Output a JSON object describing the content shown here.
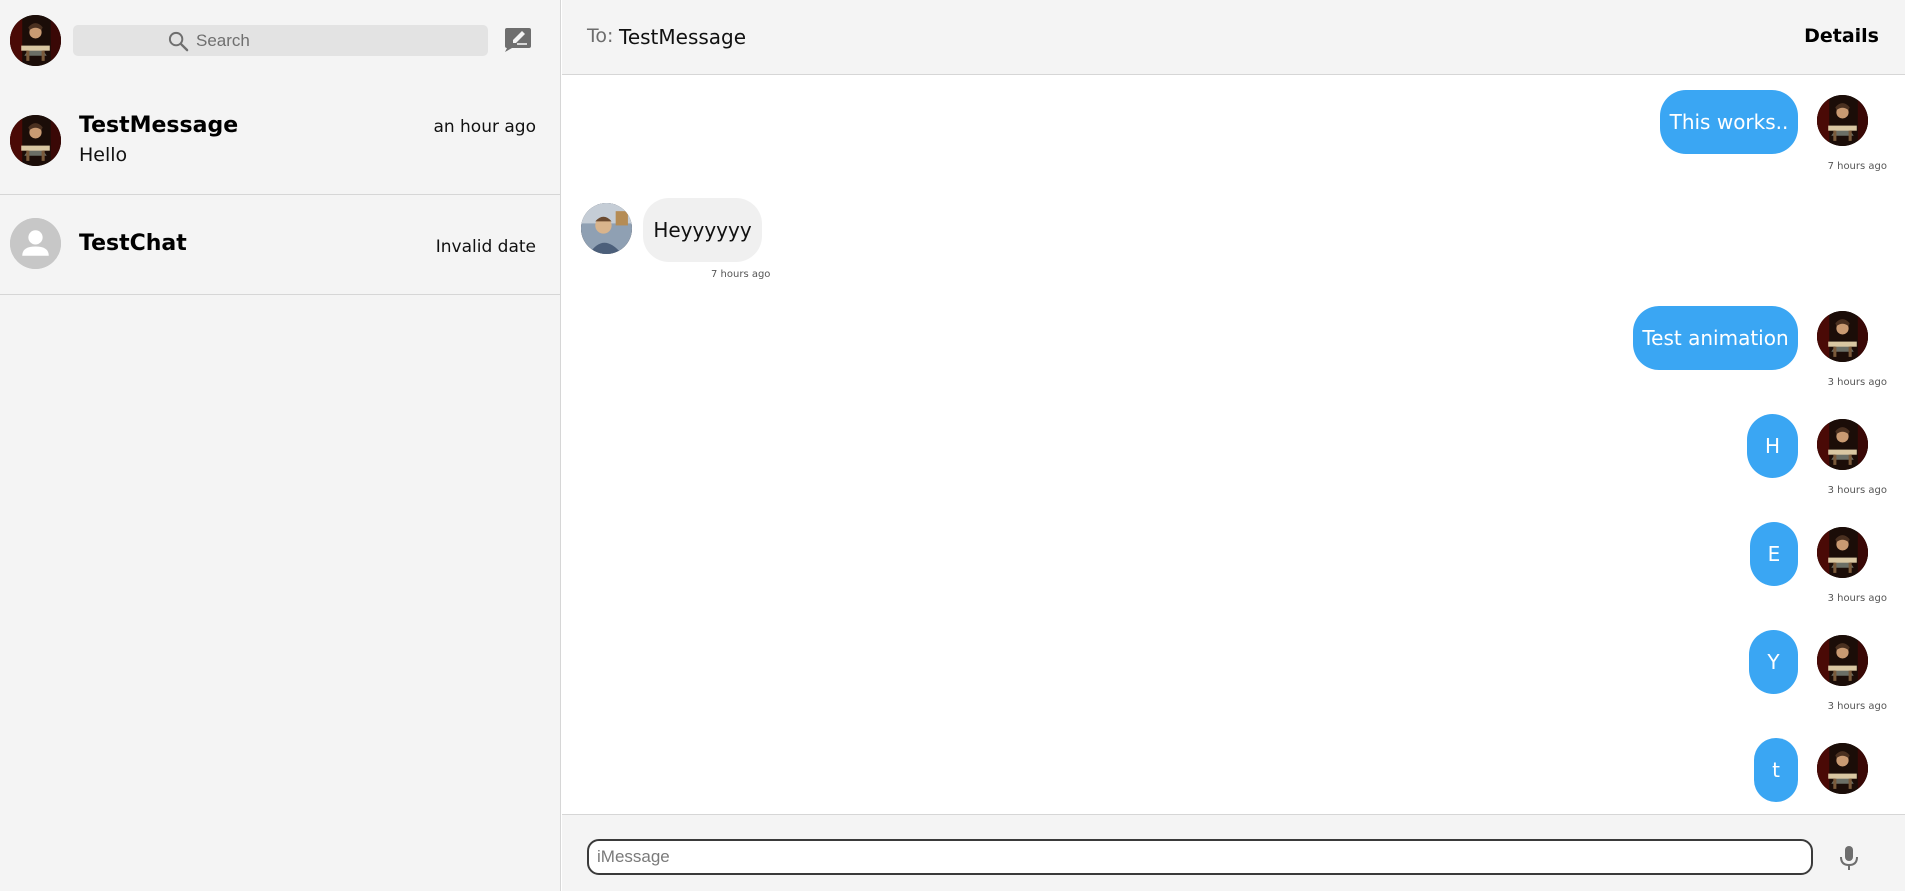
{
  "sidebar": {
    "search": {
      "placeholder": "Search"
    },
    "conversations": [
      {
        "name": "TestMessage",
        "preview": "Hello",
        "time": "an hour ago"
      },
      {
        "name": "TestChat",
        "preview": "",
        "time": "Invalid date"
      }
    ]
  },
  "header": {
    "to_label": "To:",
    "recipient": "TestMessage",
    "details_label": "Details"
  },
  "messages": [
    {
      "text": "This works..",
      "time": "7 hours ago",
      "direction": "sent"
    },
    {
      "text": "Heyyyyyy",
      "time": "7 hours ago",
      "direction": "received"
    },
    {
      "text": "Test animation",
      "time": "3 hours ago",
      "direction": "sent"
    },
    {
      "text": "H",
      "time": "3 hours ago",
      "direction": "sent"
    },
    {
      "text": "E",
      "time": "3 hours ago",
      "direction": "sent"
    },
    {
      "text": "Y",
      "time": "3 hours ago",
      "direction": "sent"
    },
    {
      "text": "t",
      "time": "",
      "direction": "sent"
    }
  ],
  "composer": {
    "placeholder": "iMessage",
    "value": ""
  },
  "colors": {
    "sent_bubble": "#3aa6f3",
    "received_bubble": "#f0f0f0",
    "panel": "#f4f4f4"
  },
  "icons": {
    "search": "search-icon",
    "compose": "compose-icon",
    "mic": "microphone-icon"
  }
}
